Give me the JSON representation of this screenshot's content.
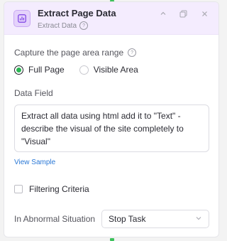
{
  "header": {
    "title": "Extract Page Data",
    "subtitle": "Extract Data",
    "help_glyph": "?",
    "icon": "chart-icon",
    "accent": "#7b3fe4"
  },
  "capture": {
    "label": "Capture the page area range",
    "help_glyph": "?",
    "options": [
      {
        "label": "Full Page",
        "checked": true
      },
      {
        "label": "Visible Area",
        "checked": false
      }
    ]
  },
  "data_field": {
    "label": "Data Field",
    "value": "Extract all data using html add it to \"Text\" - describe the visual of the site completely to \"Visual\""
  },
  "view_sample": "View Sample",
  "filter": {
    "label": "Filtering Criteria",
    "checked": false
  },
  "abnormal": {
    "label": "In Abnormal Situation",
    "selected": "Stop Task"
  },
  "colors": {
    "connector": "#3cc15b",
    "radio_checked": "#2ab553",
    "link": "#2a78d6",
    "header_bg": "#f4ecfe"
  }
}
